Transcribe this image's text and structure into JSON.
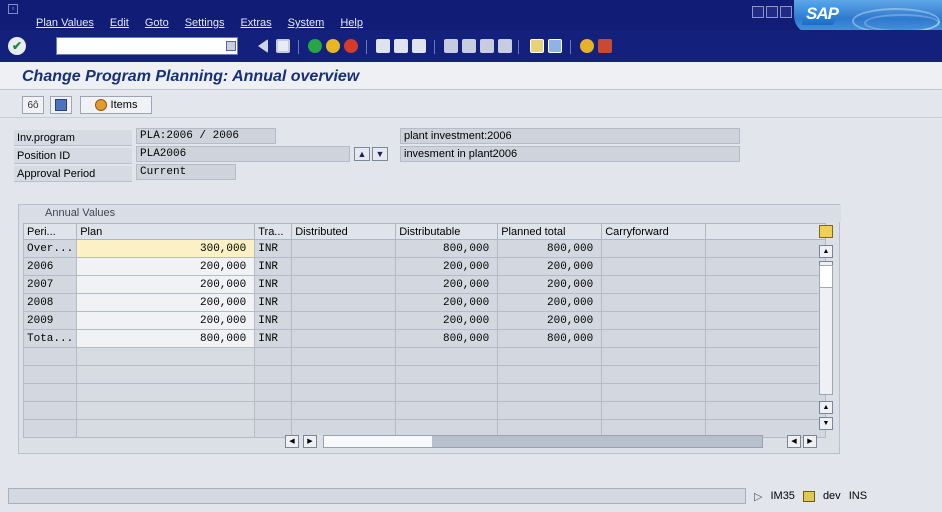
{
  "menubar": {
    "items": [
      "Plan Values",
      "Edit",
      "Goto",
      "Settings",
      "Extras",
      "System",
      "Help"
    ],
    "logo_text": "SAP"
  },
  "toolbar": {
    "command_value": "",
    "icons": [
      "enter-icon",
      "save-icon",
      "back-icon",
      "exit-icon",
      "cancel-icon",
      "print-icon",
      "find-icon",
      "find-next-icon",
      "first-page-icon",
      "previous-page-icon",
      "next-page-icon",
      "last-page-icon",
      "create-session-icon",
      "shortcut-icon",
      "help-icon",
      "layout-icon"
    ]
  },
  "title": "Change Program Planning: Annual overview",
  "app_toolbar": {
    "items_label": "Items"
  },
  "header": {
    "inv_program_label": "Inv.program",
    "inv_program_value": "PLA:2006 / 2006",
    "inv_program_desc": "plant investment:2006",
    "position_id_label": "Position ID",
    "position_id_value": "PLA2006",
    "position_id_desc": "invesment in plant2006",
    "approval_period_label": "Approval Period",
    "approval_period_value": "Current"
  },
  "table": {
    "caption": "Annual Values",
    "columns": [
      "Peri...",
      "Plan",
      "Tra...",
      "Distributed",
      "Distributable",
      "Planned total",
      "Carryforward"
    ],
    "rows": [
      {
        "period": "Over...",
        "plan": "300,000",
        "currency": "INR",
        "distributed": "",
        "distributable": "800,000",
        "planned_total": "800,000",
        "carryforward": ""
      },
      {
        "period": "2006",
        "plan": "200,000",
        "currency": "INR",
        "distributed": "",
        "distributable": "200,000",
        "planned_total": "200,000",
        "carryforward": ""
      },
      {
        "period": "2007",
        "plan": "200,000",
        "currency": "INR",
        "distributed": "",
        "distributable": "200,000",
        "planned_total": "200,000",
        "carryforward": ""
      },
      {
        "period": "2008",
        "plan": "200,000",
        "currency": "INR",
        "distributed": "",
        "distributable": "200,000",
        "planned_total": "200,000",
        "carryforward": ""
      },
      {
        "period": "2009",
        "plan": "200,000",
        "currency": "INR",
        "distributed": "",
        "distributable": "200,000",
        "planned_total": "200,000",
        "carryforward": ""
      },
      {
        "period": "Tota...",
        "plan": "800,000",
        "currency": "INR",
        "distributed": "",
        "distributable": "800,000",
        "planned_total": "800,000",
        "carryforward": ""
      }
    ],
    "empty_rows": 5
  },
  "status": {
    "transaction": "IM35",
    "client": "dev",
    "mode": "INS"
  },
  "colors": {
    "menubar_bg": "#101c76",
    "title_color": "#16307a",
    "highlight_cell": "#fcf1c6"
  }
}
